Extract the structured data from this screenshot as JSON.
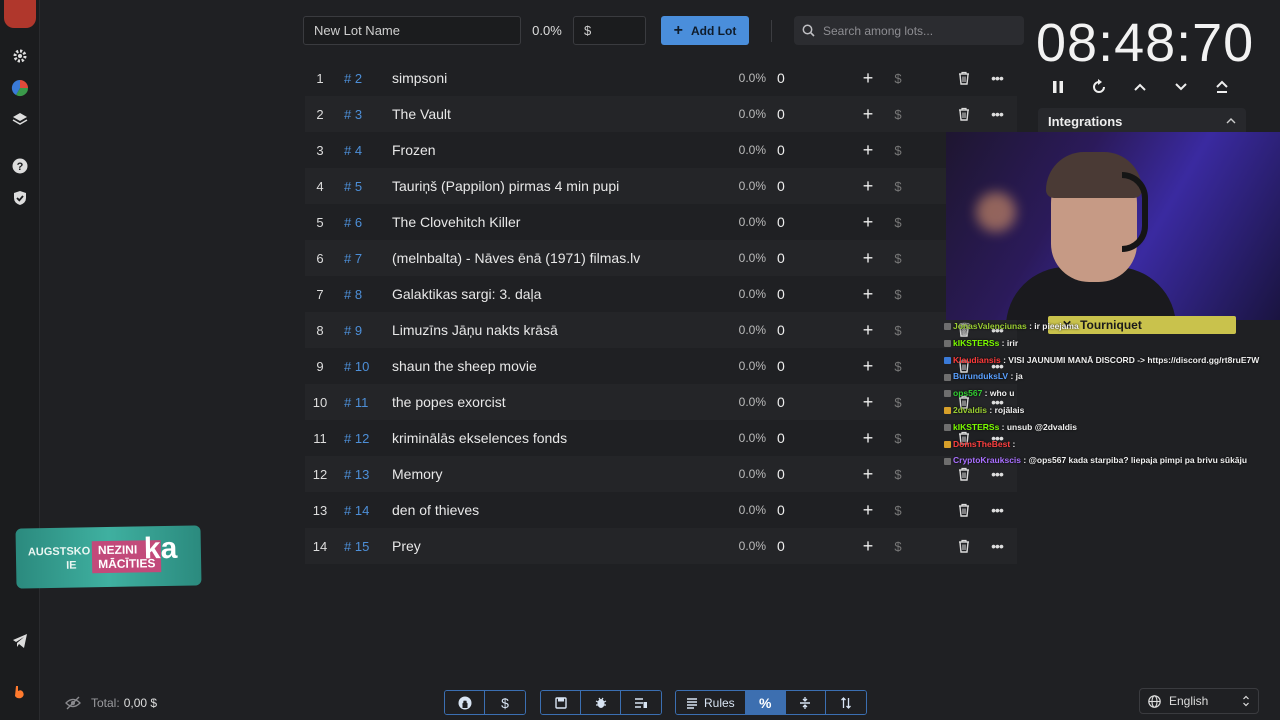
{
  "sidebar": {
    "icons": [
      "avatar",
      "settings-icon",
      "pie-chart-icon",
      "layers-icon",
      "help-icon",
      "shield-icon",
      "telegram-icon",
      "brand-icon"
    ]
  },
  "topbar": {
    "lot_name_placeholder": "New Lot Name",
    "percent": "0.0%",
    "amount_placeholder": "$",
    "add_lot_label": "Add Lot",
    "search_placeholder": "Search among lots..."
  },
  "lots": [
    {
      "num": "1",
      "id": "# 2",
      "name": "simpsoni",
      "pct": "0.0%",
      "amount": "0"
    },
    {
      "num": "2",
      "id": "# 3",
      "name": "The Vault",
      "pct": "0.0%",
      "amount": "0"
    },
    {
      "num": "3",
      "id": "# 4",
      "name": "Frozen",
      "pct": "0.0%",
      "amount": "0"
    },
    {
      "num": "4",
      "id": "# 5",
      "name": "Tauriņš (Pappilon) pirmas 4 min pupi",
      "pct": "0.0%",
      "amount": "0"
    },
    {
      "num": "5",
      "id": "# 6",
      "name": "The Clovehitch Killer",
      "pct": "0.0%",
      "amount": "0"
    },
    {
      "num": "6",
      "id": "# 7",
      "name": "(melnbalta) - Nāves ēnā (1971) filmas.lv",
      "pct": "0.0%",
      "amount": "0"
    },
    {
      "num": "7",
      "id": "# 8",
      "name": "Galaktikas sargi: 3. daļa",
      "pct": "0.0%",
      "amount": "0"
    },
    {
      "num": "8",
      "id": "# 9",
      "name": "Limuzīns Jāņu nakts krāsā",
      "pct": "0.0%",
      "amount": "0"
    },
    {
      "num": "9",
      "id": "# 10",
      "name": "shaun the sheep movie",
      "pct": "0.0%",
      "amount": "0"
    },
    {
      "num": "10",
      "id": "# 11",
      "name": "the popes exorcist",
      "pct": "0.0%",
      "amount": "0"
    },
    {
      "num": "11",
      "id": "# 12",
      "name": "kriminālās ekselences fonds",
      "pct": "0.0%",
      "amount": "0"
    },
    {
      "num": "12",
      "id": "# 13",
      "name": "Memory",
      "pct": "0.0%",
      "amount": "0"
    },
    {
      "num": "13",
      "id": "# 14",
      "name": "den of thieves",
      "pct": "0.0%",
      "amount": "0"
    },
    {
      "num": "14",
      "id": "# 15",
      "name": "Prey",
      "pct": "0.0%",
      "amount": "0"
    }
  ],
  "timer": {
    "display": "08:48:70"
  },
  "integrations": {
    "title": "Integrations",
    "tourniquet_label": "Tourniquet"
  },
  "chat": [
    {
      "user": "JonasValenciunas",
      "text": " : ir pieejama",
      "color": "#9acd32"
    },
    {
      "user": "kIKSTERSs",
      "text": " : irir",
      "color": "#7cfc00"
    },
    {
      "user": "Klaudiansis",
      "text": " : VISI JAUNUMI MANĀ DISCORD -> https://discord.gg/rt8ruE7W",
      "color": "#ff3b3b"
    },
    {
      "user": "BurunduksLV",
      "text": " : ja",
      "color": "#5aa0ff"
    },
    {
      "user": "ops567",
      "text": " : who u",
      "color": "#32cd32"
    },
    {
      "user": "2dvaldis",
      "text": " : rojālais",
      "color": "#9acd32"
    },
    {
      "user": "kIKSTERSs",
      "text": " : unsub @2dvaldis",
      "color": "#7cfc00"
    },
    {
      "user": "DomsTheBest",
      "text": " : ",
      "color": "#ff4040"
    },
    {
      "user": "CryptoKraukscis",
      "text": " : @ops567 kada starpiba? liepaja pimpi pa brivu sūkāju",
      "color": "#a970ff"
    }
  ],
  "sticker": {
    "line1": "AUGSTSKO",
    "line1b": "IE",
    "highlight1": "NEZINI",
    "highlight2": "MĀCĪTIES",
    "big": "ka"
  },
  "footer": {
    "total_label": "Total:",
    "total_value": "0,00 $",
    "rules_label": "Rules",
    "dollar_label": "$",
    "language": "English"
  }
}
